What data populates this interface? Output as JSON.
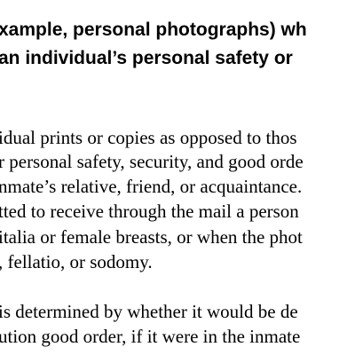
{
  "heading": {
    "lines": [
      "xample, personal photographs) wh",
      "an individual’s personal safety or"
    ]
  },
  "body": {
    "paragraph1": [
      "idual prints or copies as opposed to thos",
      "r personal safety, security, and good orde",
      "nmate’s relative, friend, or acquaintance.",
      "tted to receive through the mail a person",
      "italia or female breasts, or when the phot",
      ", fellatio, or sodomy."
    ],
    "paragraph2": [
      "is determined by whether it would be de",
      "ution good order, if it were in the inmate"
    ]
  }
}
